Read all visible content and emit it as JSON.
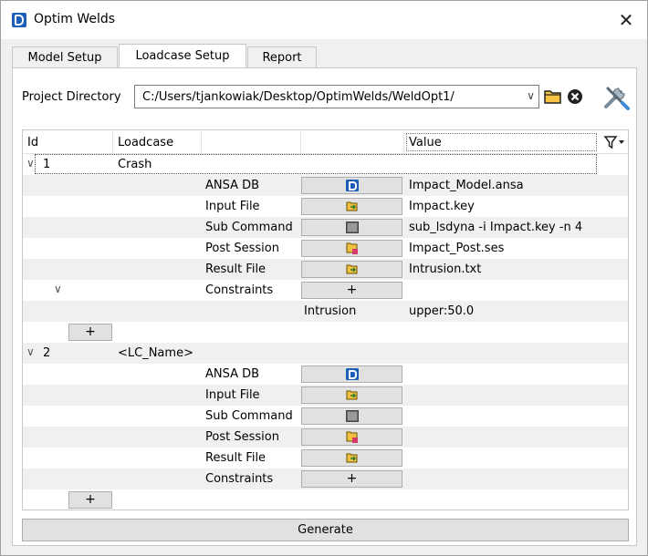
{
  "window": {
    "title": "Optim Welds",
    "close_symbol": "✕"
  },
  "tabs": [
    {
      "label": "Model Setup",
      "active": false
    },
    {
      "label": "Loadcase Setup",
      "active": true
    },
    {
      "label": "Report",
      "active": false
    }
  ],
  "project": {
    "label": "Project Directory",
    "value": "C:/Users/tjankowiak/Desktop/OptimWelds/WeldOpt1/"
  },
  "table": {
    "headers": {
      "id": "Id",
      "loadcase": "Loadcase",
      "value": "Value"
    },
    "add_button_label": "+",
    "loadcases": [
      {
        "id": "1",
        "name": "Crash",
        "fields": [
          {
            "label": "ANSA DB",
            "icon": "ansa-icon",
            "value": "Impact_Model.ansa"
          },
          {
            "label": "Input File",
            "icon": "open-file-icon",
            "value": "Impact.key"
          },
          {
            "label": "Sub Command",
            "icon": "terminal-icon",
            "value": "sub_lsdyna -i Impact.key -n 4"
          },
          {
            "label": "Post Session",
            "icon": "session-file-icon",
            "value": "Impact_Post.ses"
          },
          {
            "label": "Result File",
            "icon": "open-file-icon",
            "value": "Intrusion.txt"
          },
          {
            "label": "Constraints",
            "icon": "plus",
            "button_text": "+",
            "value": ""
          }
        ],
        "constraints": [
          {
            "name": "Intrusion",
            "value": "upper:50.0"
          }
        ]
      },
      {
        "id": "2",
        "name": "<LC_Name>",
        "fields": [
          {
            "label": "ANSA DB",
            "icon": "ansa-icon",
            "value": ""
          },
          {
            "label": "Input File",
            "icon": "open-file-icon",
            "value": ""
          },
          {
            "label": "Sub Command",
            "icon": "terminal-icon",
            "value": ""
          },
          {
            "label": "Post Session",
            "icon": "session-file-icon",
            "value": ""
          },
          {
            "label": "Result File",
            "icon": "open-file-icon",
            "value": ""
          },
          {
            "label": "Constraints",
            "icon": "plus",
            "button_text": "+",
            "value": ""
          }
        ],
        "constraints": []
      }
    ]
  },
  "generate_label": "Generate",
  "colors": {
    "accent": "#1c5fb8",
    "row_alt": "#f0f0f0",
    "button_face": "#e1e1e1"
  }
}
